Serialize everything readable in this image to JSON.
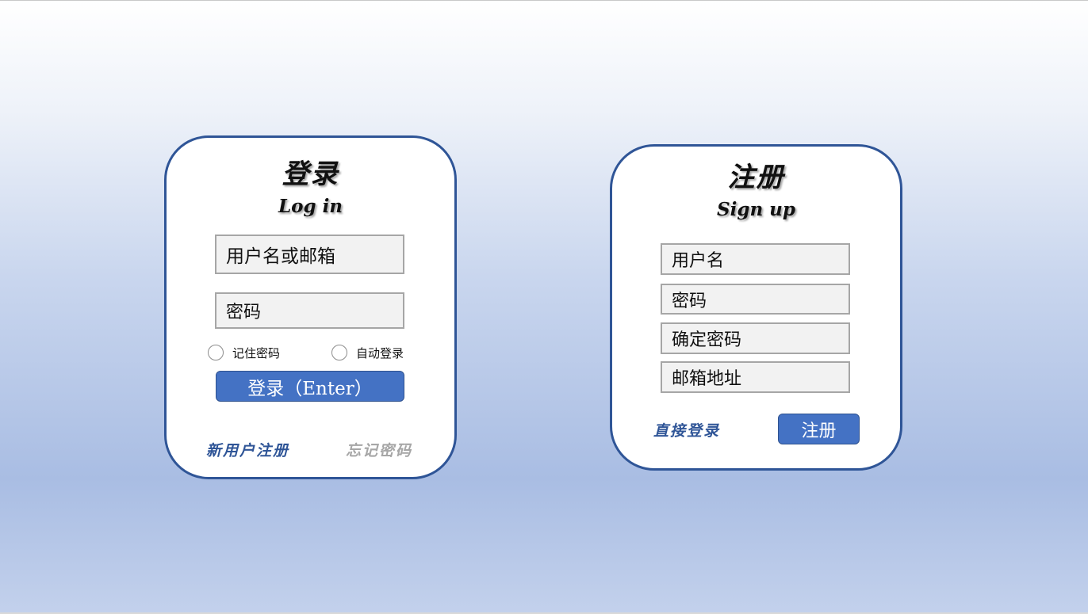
{
  "login": {
    "title": "登录",
    "subtitle": "Log in",
    "username_placeholder": "用户名或邮箱",
    "password_placeholder": "密码",
    "remember_label": "记住密码",
    "autologin_label": "自动登录",
    "submit_label": "登录（Enter）",
    "register_link": "新用户注册",
    "forgot_link": "忘记密码"
  },
  "signup": {
    "title": "注册",
    "subtitle": "Sign up",
    "username_placeholder": "用户名",
    "password_placeholder": "密码",
    "confirm_placeholder": "确定密码",
    "email_placeholder": "邮箱地址",
    "login_link": "直接登录",
    "submit_label": "注册"
  },
  "colors": {
    "accent": "#4472c4",
    "card_border": "#2f5597",
    "link": "#2f5597",
    "link_muted": "#a6a6a6",
    "field_bg": "#f2f2f2"
  }
}
